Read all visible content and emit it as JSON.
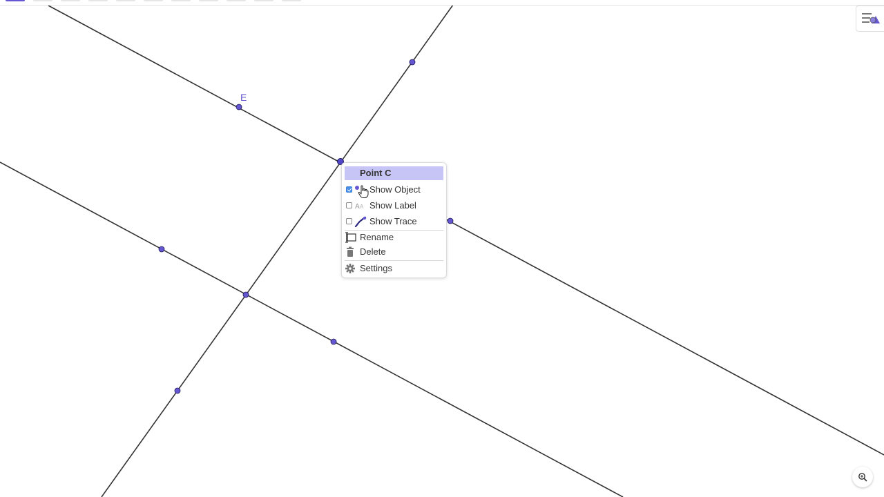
{
  "toolbar": {
    "active_color": "#6557d2",
    "tool_count": 11
  },
  "canvas": {
    "point_color": "#6557d2",
    "line_color": "#333333",
    "point_label_e": "E"
  },
  "context_menu": {
    "title": "Point C",
    "title_bg": "#c7c5f5",
    "items": [
      {
        "label": "Show Object",
        "checked": true,
        "icon": "point-icon"
      },
      {
        "label": "Show Label",
        "checked": false,
        "icon": "label-aa-icon"
      },
      {
        "label": "Show Trace",
        "checked": false,
        "icon": "trace-icon"
      },
      {
        "label": "Rename",
        "icon": "rename-icon"
      },
      {
        "label": "Delete",
        "icon": "trash-icon"
      },
      {
        "label": "Settings",
        "icon": "gear-icon"
      }
    ]
  },
  "controls": {
    "style_bar_icon": "style-bar-toggle-icon",
    "zoom_icon": "zoom-magnifier-icon"
  }
}
